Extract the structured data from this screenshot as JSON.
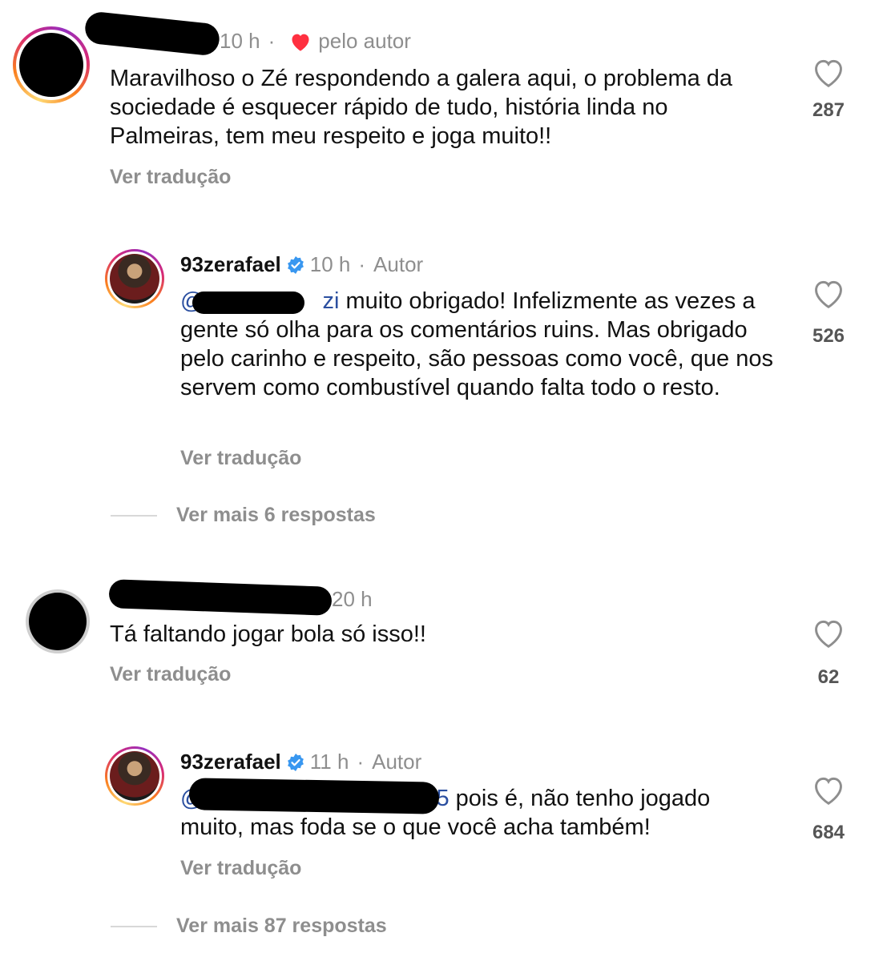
{
  "comments": [
    {
      "time": "10 h",
      "dot": "·",
      "liked_by_author_label": "pelo autor",
      "text": "Maravilhoso o Zé respondendo a galera aqui, o problema da sociedade é esquecer rápido de tudo, história linda no Palmeiras, tem meu respeito e joga muito!!",
      "translate": "Ver tradução",
      "likes": "287",
      "reply": {
        "username": "93zerafael",
        "time": "10 h",
        "dot": "·",
        "role": "Autor",
        "mention": "@",
        "mention_tail": "zi",
        "text": " muito obrigado! Infelizmente as vezes a gente só olha para os comentários ruins. Mas obrigado pelo carinho e respeito, são pessoas como você, que nos servem como combustível quando falta todo o resto.",
        "translate": "Ver tradução",
        "likes": "526"
      },
      "more_replies": "Ver mais 6 respostas"
    },
    {
      "time": "20 h",
      "text": "Tá faltando jogar bola só isso!!",
      "translate": "Ver tradução",
      "likes": "62",
      "reply": {
        "username": "93zerafael",
        "time": "11 h",
        "dot": "·",
        "role": "Autor",
        "mention": "@",
        "mention_tail": "5",
        "text": " pois é, não tenho jogado muito, mas foda se o que você acha também!",
        "translate": "Ver tradução",
        "likes": "684"
      },
      "more_replies": "Ver mais 87 respostas"
    }
  ],
  "colors": {
    "liked_heart": "#ff3040",
    "verified": "#3897f0",
    "mention": "#2b4fa0",
    "muted": "#8e8e8e"
  },
  "icons": {
    "like": "heart-outline-icon",
    "liked_by_author": "heart-filled-icon",
    "verified": "verified-badge-icon"
  }
}
